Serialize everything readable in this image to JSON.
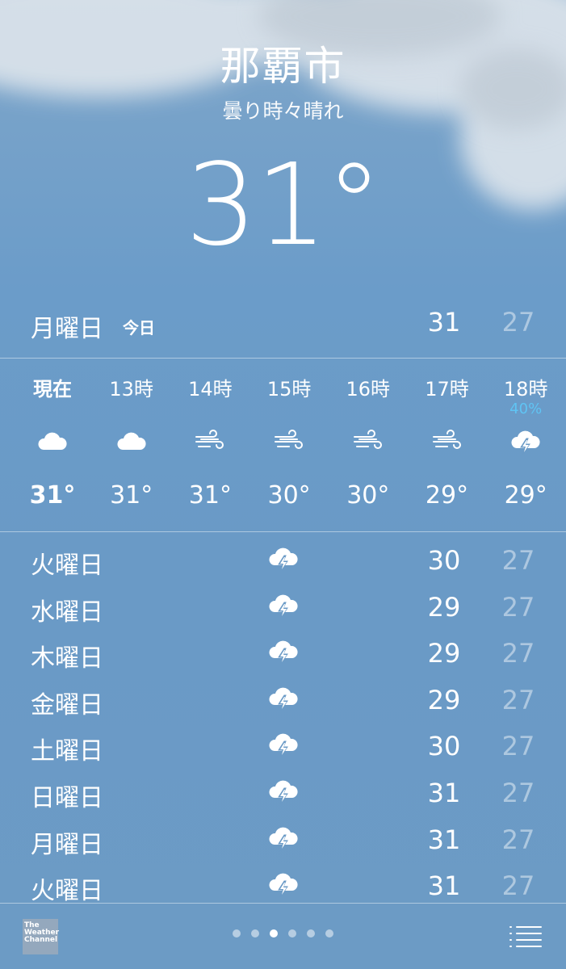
{
  "location": {
    "city": "那覇市",
    "condition": "曇り時々晴れ",
    "temperature": "31°"
  },
  "today": {
    "day": "月曜日",
    "tag": "今日",
    "high": "31",
    "low": "27"
  },
  "hourly": [
    {
      "time": "現在",
      "icon": "cloud-icon",
      "temp": "31°",
      "pop": ""
    },
    {
      "time": "13時",
      "icon": "cloud-icon",
      "temp": "31°",
      "pop": ""
    },
    {
      "time": "14時",
      "icon": "wind-icon",
      "temp": "31°",
      "pop": ""
    },
    {
      "time": "15時",
      "icon": "wind-icon",
      "temp": "30°",
      "pop": ""
    },
    {
      "time": "16時",
      "icon": "wind-icon",
      "temp": "30°",
      "pop": ""
    },
    {
      "time": "17時",
      "icon": "wind-icon",
      "temp": "29°",
      "pop": ""
    },
    {
      "time": "18時",
      "icon": "thunderstorm-icon",
      "temp": "29°",
      "pop": "40%"
    }
  ],
  "daily": [
    {
      "day": "火曜日",
      "icon": "thunderstorm-icon",
      "high": "30",
      "low": "27"
    },
    {
      "day": "水曜日",
      "icon": "thunderstorm-icon",
      "high": "29",
      "low": "27"
    },
    {
      "day": "木曜日",
      "icon": "thunderstorm-icon",
      "high": "29",
      "low": "27"
    },
    {
      "day": "金曜日",
      "icon": "thunderstorm-icon",
      "high": "29",
      "low": "27"
    },
    {
      "day": "土曜日",
      "icon": "thunderstorm-icon",
      "high": "30",
      "low": "27"
    },
    {
      "day": "日曜日",
      "icon": "thunderstorm-icon",
      "high": "31",
      "low": "27"
    },
    {
      "day": "月曜日",
      "icon": "thunderstorm-icon",
      "high": "31",
      "low": "27"
    },
    {
      "day": "火曜日",
      "icon": "thunderstorm-icon",
      "high": "31",
      "low": "27"
    }
  ],
  "footer": {
    "logo_lines": [
      "The",
      "Weather",
      "Channel"
    ],
    "page_count": 6,
    "active_page": 3,
    "list_icon": "list-icon"
  },
  "colors": {
    "background": "#6a9ac6",
    "pop": "#5fc4f4",
    "low_temp": "rgba(255,255,255,0.45)"
  }
}
